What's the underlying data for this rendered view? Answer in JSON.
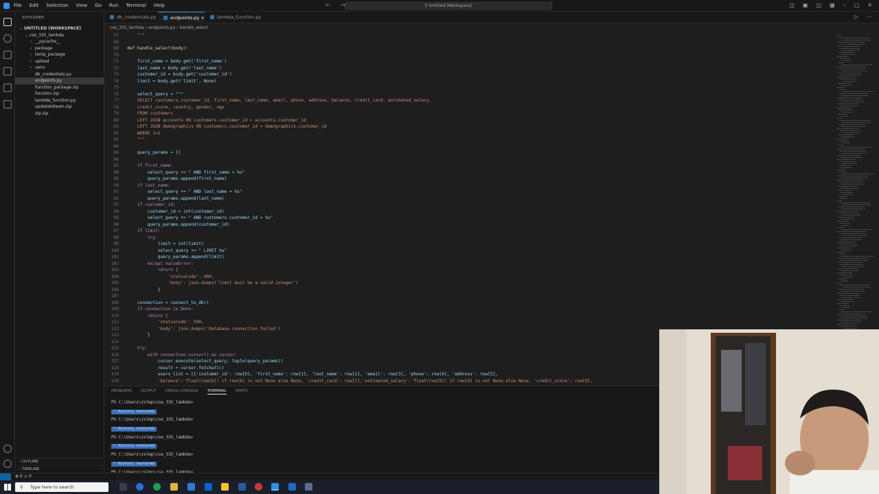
{
  "titlebar": {
    "menu": [
      "File",
      "Edit",
      "Selection",
      "View",
      "Go",
      "Run",
      "Terminal",
      "Help"
    ],
    "search": "Untitled (Workspace)"
  },
  "sidebar": {
    "header": "EXPLORER",
    "items": [
      {
        "label": "UNTITLED (WORKSPACE)",
        "indent": 0,
        "chev": "⌄",
        "sel": false
      },
      {
        "label": "cse_335_lambda",
        "indent": 1,
        "chev": "⌄",
        "sel": false
      },
      {
        "label": "__pycache__",
        "indent": 2,
        "chev": "›",
        "sel": false
      },
      {
        "label": "package",
        "indent": 2,
        "chev": "›",
        "sel": false
      },
      {
        "label": "temp_package",
        "indent": 2,
        "chev": "›",
        "sel": false
      },
      {
        "label": "upload",
        "indent": 2,
        "chev": "›",
        "sel": false
      },
      {
        "label": "venv",
        "indent": 2,
        "chev": "›",
        "sel": false
      },
      {
        "label": "db_credentials.py",
        "indent": 2,
        "chev": "",
        "sel": false
      },
      {
        "label": "endpoints.py",
        "indent": 2,
        "chev": "",
        "sel": true
      },
      {
        "label": "function_package.zip",
        "indent": 2,
        "chev": "",
        "sel": false
      },
      {
        "label": "function.zip",
        "indent": 2,
        "chev": "",
        "sel": false
      },
      {
        "label": "lambda_function.py",
        "indent": 2,
        "chev": "",
        "sel": false
      },
      {
        "label": "updatetoteam.zip",
        "indent": 2,
        "chev": "",
        "sel": false
      },
      {
        "label": "zip.zip",
        "indent": 2,
        "chev": "",
        "sel": false
      }
    ],
    "outline": "OUTLINE",
    "timeline": "TIMELINE"
  },
  "tabs": [
    "db_credentials.py",
    "endpoints.py",
    "lambda_function.py"
  ],
  "breadcrumb": "cse_335_lambda  ›  endpoints.py  ›  handle_select",
  "code": [
    {
      "n": "67",
      "t": "    \"\"\""
    },
    {
      "n": "68",
      "t": ""
    },
    {
      "n": "69",
      "t": "def handle_select(body):"
    },
    {
      "n": "70",
      "t": ""
    },
    {
      "n": "71",
      "t": "    first_name = body.get('first_name')"
    },
    {
      "n": "72",
      "t": "    last_name = body.get('last_name')"
    },
    {
      "n": "73",
      "t": "    customer_id = body.get('customer_id')"
    },
    {
      "n": "74",
      "t": "    limit = body.get('limit', None)"
    },
    {
      "n": "75",
      "t": ""
    },
    {
      "n": "76",
      "t": "    select_query = \"\"\""
    },
    {
      "n": "77",
      "t": "    SELECT customers.customer_id, first_name, last_name, email, phone, address, balance, credit_card, estimated_salary,"
    },
    {
      "n": "78",
      "t": "    credit_score, country, gender, age"
    },
    {
      "n": "79",
      "t": "    FROM customers"
    },
    {
      "n": "80",
      "t": "    LEFT JOIN accounts ON customers.customer_id = accounts.customer_id"
    },
    {
      "n": "81",
      "t": "    LEFT JOIN demographics ON customers.customer_id = demographics.customer_id"
    },
    {
      "n": "82",
      "t": "    WHERE 1=1"
    },
    {
      "n": "83",
      "t": "    \"\"\""
    },
    {
      "n": "84",
      "t": ""
    },
    {
      "n": "85",
      "t": "    query_params = []"
    },
    {
      "n": "86",
      "t": ""
    },
    {
      "n": "87",
      "t": "    if first_name:"
    },
    {
      "n": "88",
      "t": "        select_query += \" AND first_name = %s\""
    },
    {
      "n": "89",
      "t": "        query_params.append(first_name)"
    },
    {
      "n": "90",
      "t": "    if last_name:"
    },
    {
      "n": "91",
      "t": "        select_query += \" AND last_name = %s\""
    },
    {
      "n": "92",
      "t": "        query_params.append(last_name)"
    },
    {
      "n": "93",
      "t": "    if customer_id:"
    },
    {
      "n": "94",
      "t": "        customer_id = int(customer_id)"
    },
    {
      "n": "95",
      "t": "        select_query += \" AND customers.customer_id = %s\""
    },
    {
      "n": "96",
      "t": "        query_params.append(customer_id)"
    },
    {
      "n": "97",
      "t": "    if limit:"
    },
    {
      "n": "98",
      "t": "        try:"
    },
    {
      "n": "99",
      "t": "            limit = int(limit)"
    },
    {
      "n": "100",
      "t": "            select_query += \" LIMIT %s\""
    },
    {
      "n": "101",
      "t": "            query_params.append(limit)"
    },
    {
      "n": "102",
      "t": "        except ValueError:"
    },
    {
      "n": "103",
      "t": "            return {"
    },
    {
      "n": "104",
      "t": "                'statusCode': 400,"
    },
    {
      "n": "105",
      "t": "                'body': json.dumps('limit must be a valid integer')"
    },
    {
      "n": "106",
      "t": "            }"
    },
    {
      "n": "107",
      "t": ""
    },
    {
      "n": "108",
      "t": "    connection = connect_to_db()"
    },
    {
      "n": "109",
      "t": "    if connection is None:"
    },
    {
      "n": "110",
      "t": "        return {"
    },
    {
      "n": "111",
      "t": "            'statusCode': 500,"
    },
    {
      "n": "112",
      "t": "            'body': json.dumps('Database connection failed')"
    },
    {
      "n": "113",
      "t": "        }"
    },
    {
      "n": "114",
      "t": ""
    },
    {
      "n": "115",
      "t": "    try:"
    },
    {
      "n": "116",
      "t": "        with connection.cursor() as cursor:"
    },
    {
      "n": "117",
      "t": "            cursor.execute(select_query, tuple(query_params))"
    },
    {
      "n": "118",
      "t": "            result = cursor.fetchall()"
    },
    {
      "n": "119",
      "t": "            users_list = [{'customer_id': row[0], 'first_name': row[1], 'last_name': row[2], 'email': row[3], 'phone': row[4], 'address': row[5],"
    },
    {
      "n": "120",
      "t": "            'balance': float(row[6]) if row[6] is not None else None, 'credit_card': row[7],'estimated_salary': float(row[8]) if row[8] is not None else None, 'credit_score': row[9],"
    }
  ],
  "panel": {
    "tabs": [
      "PROBLEMS",
      "OUTPUT",
      "DEBUG CONSOLE",
      "TERMINAL",
      "PORTS"
    ],
    "active": "TERMINAL",
    "prompt": "PS C:\\Users\\zslmp\\cse_335_lambda>",
    "history": "History restored"
  },
  "statusbar": {
    "left": "⊗ 0  ⚠ 0"
  },
  "taskbar": {
    "search": "Type here to search"
  }
}
